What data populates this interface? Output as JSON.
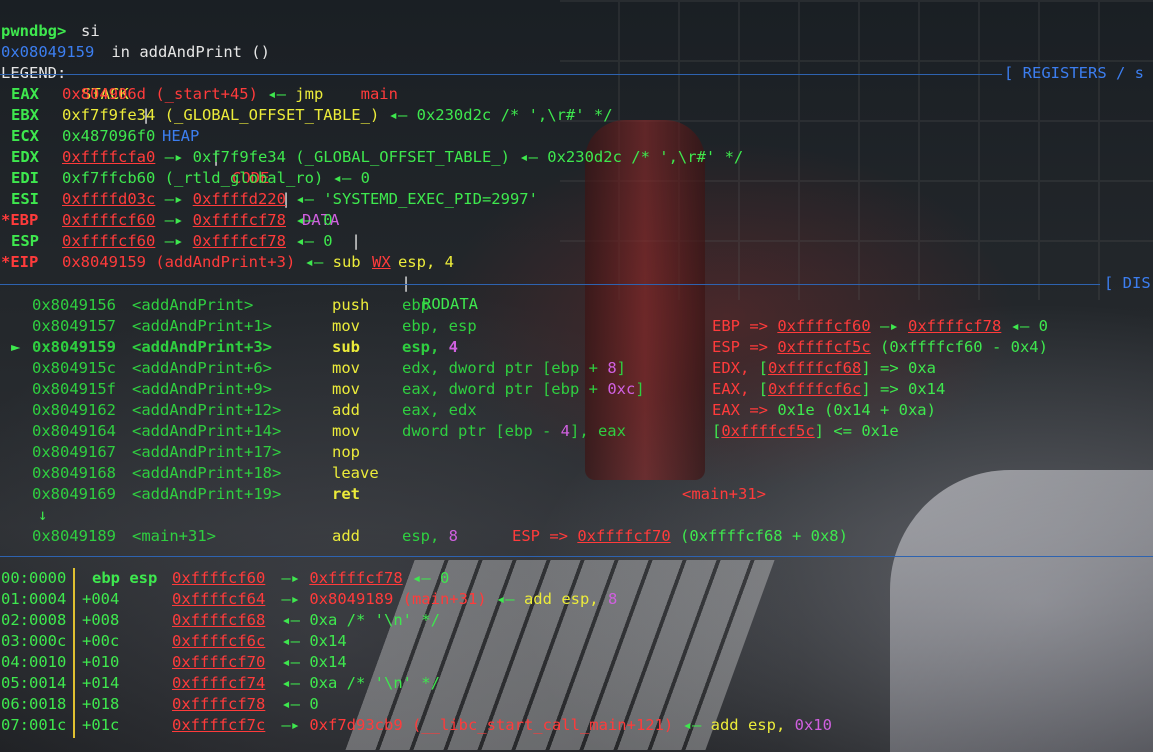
{
  "prompt": {
    "text": "pwndbg> ",
    "cmd": "si"
  },
  "location": {
    "addr": "0x08049159",
    "text": " in addAndPrint ()"
  },
  "legend": {
    "label": "LEGEND: ",
    "stack": "STACK",
    "heap": "HEAP",
    "code": "CODE",
    "data": "DATA",
    "wx": "WX",
    "rodata": "RODATA",
    "sep": " | "
  },
  "headers": {
    "registers": "[ REGISTERS / s",
    "disasm": "[ DIS"
  },
  "registers": [
    {
      "name": "EAX",
      "parts": [
        [
          "r",
          "0x804906d (_start+45)"
        ],
        [
          "g",
          " ◂— "
        ],
        [
          "y",
          "jmp"
        ],
        [
          "w",
          "    "
        ],
        [
          "r",
          "main"
        ]
      ]
    },
    {
      "name": "EBX",
      "parts": [
        [
          "y",
          "0xf7f9fe34 (_GLOBAL_OFFSET_TABLE_)"
        ],
        [
          "g",
          " ◂— 0x230d2c /* ',\\r#' */"
        ]
      ]
    },
    {
      "name": "ECX",
      "parts": [
        [
          "g",
          "0x487096f0"
        ]
      ]
    },
    {
      "name": "EDX",
      "parts": [
        [
          "ru",
          "0xffffcfa0"
        ],
        [
          "g",
          " —▸ 0xf7f9fe34 (_GLOBAL_OFFSET_TABLE_) ◂— 0x230d2c /* ',\\r#' */"
        ]
      ]
    },
    {
      "name": "EDI",
      "parts": [
        [
          "g",
          "0xf7ffcb60 (_rtld_global_ro) ◂— 0"
        ]
      ]
    },
    {
      "name": "ESI",
      "parts": [
        [
          "ru",
          "0xffffd03c"
        ],
        [
          "g",
          " —▸ "
        ],
        [
          "ru",
          "0xffffd220"
        ],
        [
          "g",
          " ◂— 'SYSTEMD_EXEC_PID=2997'"
        ]
      ]
    },
    {
      "name": "*EBP",
      "parts": [
        [
          "ru",
          "0xffffcf60"
        ],
        [
          "g",
          " —▸ "
        ],
        [
          "ru",
          "0xffffcf78"
        ],
        [
          "g",
          " ◂— 0"
        ]
      ]
    },
    {
      "name": "ESP",
      "parts": [
        [
          "ru",
          "0xffffcf60"
        ],
        [
          "g",
          " —▸ "
        ],
        [
          "ru",
          "0xffffcf78"
        ],
        [
          "g",
          " ◂— 0"
        ]
      ]
    },
    {
      "name": "*EIP",
      "parts": [
        [
          "r",
          "0x8049159 (addAndPrint+3)"
        ],
        [
          "g",
          " ◂— "
        ],
        [
          "y",
          "sub"
        ],
        [
          "w",
          "    "
        ],
        [
          "y",
          "esp, 4"
        ]
      ]
    }
  ],
  "disasm": [
    {
      "addr": "0x8049156",
      "sym": "<addAndPrint>",
      "op": "push",
      "args": [
        [
          "dg",
          "ebp"
        ]
      ],
      "note": []
    },
    {
      "addr": "0x8049157",
      "sym": "<addAndPrint+1>",
      "op": "mov",
      "args": [
        [
          "dg",
          "ebp, esp"
        ]
      ],
      "note": [
        [
          "r",
          "EBP => "
        ],
        [
          "ru",
          "0xffffcf60"
        ],
        [
          "g",
          " —▸ "
        ],
        [
          "ru",
          "0xffffcf78"
        ],
        [
          "g",
          " ◂— 0"
        ]
      ]
    },
    {
      "addr": "0x8049159",
      "sym": "<addAndPrint+3>",
      "op": "sub",
      "args": [
        [
          "dg",
          "esp, "
        ],
        [
          "m",
          "4"
        ]
      ],
      "note": [
        [
          "r",
          "ESP => "
        ],
        [
          "ru",
          "0xffffcf5c"
        ],
        [
          "g",
          " (0xffffcf60 - 0x4)"
        ]
      ],
      "current": true
    },
    {
      "addr": "0x804915c",
      "sym": "<addAndPrint+6>",
      "op": "mov",
      "args": [
        [
          "dg",
          "edx, dword ptr [ebp + "
        ],
        [
          "m",
          "8"
        ],
        [
          "dg",
          "]"
        ]
      ],
      "note": [
        [
          "r",
          "EDX, "
        ],
        [
          "g",
          "["
        ],
        [
          "ru",
          "0xffffcf68"
        ],
        [
          "g",
          "] => 0xa"
        ]
      ]
    },
    {
      "addr": "0x804915f",
      "sym": "<addAndPrint+9>",
      "op": "mov",
      "args": [
        [
          "dg",
          "eax, dword ptr [ebp + "
        ],
        [
          "m",
          "0xc"
        ],
        [
          "dg",
          "]"
        ]
      ],
      "note": [
        [
          "r",
          "EAX, "
        ],
        [
          "g",
          "["
        ],
        [
          "ru",
          "0xffffcf6c"
        ],
        [
          "g",
          "] => 0x14"
        ]
      ]
    },
    {
      "addr": "0x8049162",
      "sym": "<addAndPrint+12>",
      "op": "add",
      "args": [
        [
          "dg",
          "eax, edx"
        ]
      ],
      "note": [
        [
          "r",
          "EAX => "
        ],
        [
          "g",
          "0x1e (0x14 + 0xa)"
        ]
      ]
    },
    {
      "addr": "0x8049164",
      "sym": "<addAndPrint+14>",
      "op": "mov",
      "args": [
        [
          "dg",
          "dword ptr [ebp - "
        ],
        [
          "m",
          "4"
        ],
        [
          "dg",
          "], eax"
        ]
      ],
      "note": [
        [
          "g",
          "["
        ],
        [
          "ru",
          "0xffffcf5c"
        ],
        [
          "g",
          "] <= 0x1e"
        ]
      ]
    },
    {
      "addr": "0x8049167",
      "sym": "<addAndPrint+17>",
      "op": "nop",
      "args": [],
      "note": []
    },
    {
      "addr": "0x8049168",
      "sym": "<addAndPrint+18>",
      "op": "leave",
      "args": [],
      "note": []
    },
    {
      "addr": "0x8049169",
      "sym": "<addAndPrint+19>",
      "op": "ret",
      "args": [],
      "note": [],
      "ret": "<main+31>"
    }
  ],
  "jump_arrow": "↓",
  "after_jump": {
    "addr": "0x8049189",
    "sym": "<main+31>",
    "op": "add",
    "args": [
      [
        "dg",
        "esp, "
      ],
      [
        "m",
        "8"
      ]
    ],
    "note": [
      [
        "r",
        "ESP => "
      ],
      [
        "ru",
        "0xffffcf70"
      ],
      [
        "g",
        " (0xffffcf68 + 0x8)"
      ]
    ]
  },
  "current_marker": "►",
  "stack": [
    {
      "idx": "00:0000",
      "off": "ebp esp",
      "addr": "0xffffcf60",
      "rest": [
        [
          "g",
          " —▸ "
        ],
        [
          "ru",
          "0xffffcf78"
        ],
        [
          "g",
          " ◂— 0"
        ]
      ],
      "bold": true
    },
    {
      "idx": "01:0004",
      "off": "+004",
      "addr": "0xffffcf64",
      "rest": [
        [
          "g",
          " —▸ "
        ],
        [
          "r",
          "0x8049189 (main+31)"
        ],
        [
          "g",
          " ◂— "
        ],
        [
          "y",
          "add"
        ],
        [
          "w",
          " "
        ],
        [
          "y",
          "esp, "
        ],
        [
          "m",
          "8"
        ]
      ]
    },
    {
      "idx": "02:0008",
      "off": "+008",
      "addr": "0xffffcf68",
      "rest": [
        [
          "g",
          " ◂— 0xa /* '\\n' */"
        ]
      ]
    },
    {
      "idx": "03:000c",
      "off": "+00c",
      "addr": "0xffffcf6c",
      "rest": [
        [
          "g",
          " ◂— 0x14"
        ]
      ]
    },
    {
      "idx": "04:0010",
      "off": "+010",
      "addr": "0xffffcf70",
      "rest": [
        [
          "g",
          " ◂— 0x14"
        ]
      ]
    },
    {
      "idx": "05:0014",
      "off": "+014",
      "addr": "0xffffcf74",
      "rest": [
        [
          "g",
          " ◂— 0xa /* '\\n' */"
        ]
      ]
    },
    {
      "idx": "06:0018",
      "off": "+018",
      "addr": "0xffffcf78",
      "rest": [
        [
          "g",
          " ◂— 0"
        ]
      ]
    },
    {
      "idx": "07:001c",
      "off": "+01c",
      "addr": "0xffffcf7c",
      "rest": [
        [
          "g",
          " —▸ "
        ],
        [
          "r",
          "0xf7d93cb9 (__libc_start_call_main+121)"
        ],
        [
          "g",
          " ◂— "
        ],
        [
          "y",
          "add"
        ],
        [
          "w",
          " "
        ],
        [
          "y",
          "esp, "
        ],
        [
          "m",
          "0x10"
        ]
      ]
    }
  ],
  "colors": {
    "green": "#3ee84e",
    "red": "#ff3b3b",
    "yellow": "#ecec3a",
    "blue": "#3c7ef0",
    "magenta": "#d060e0",
    "cyan": "#38b6d8"
  }
}
